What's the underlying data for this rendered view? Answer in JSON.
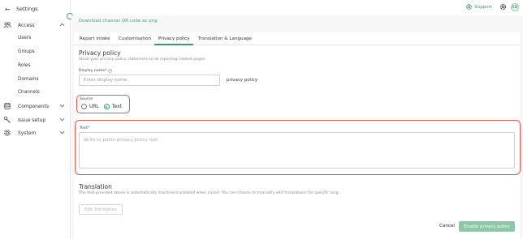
{
  "sidebar": {
    "back_label": "Settings",
    "items": [
      {
        "label": "Access",
        "icon": "users-icon",
        "expanded": true
      },
      {
        "label": "Components",
        "icon": "database-icon",
        "expanded": false
      },
      {
        "label": "Issue setup",
        "icon": "wrench-icon",
        "expanded": false
      },
      {
        "label": "System",
        "icon": "gear-icon",
        "expanded": false
      }
    ],
    "access_subitems": [
      "Users",
      "Groups",
      "Roles",
      "Domains",
      "Channels"
    ]
  },
  "topbar": {
    "support_label": "Support",
    "avatar_initials": "KD"
  },
  "download_link": "Download channel QR code as png",
  "tabs": [
    {
      "label": "Report intake",
      "active": false
    },
    {
      "label": "Customisation",
      "active": false
    },
    {
      "label": "Privacy policy",
      "active": true
    },
    {
      "label": "Translation & Language",
      "active": false
    }
  ],
  "privacy": {
    "title": "Privacy policy",
    "subtitle": "Show your privacy policy statement on all reporting related pages.",
    "display_name_label": "Display name*",
    "display_name_placeholder": "Enter display name",
    "display_name_suffix": "privacy policy",
    "source_label": "Source",
    "source_options": [
      "URL",
      "Text"
    ],
    "source_selected": "Text",
    "text_label": "Text*",
    "text_placeholder": "Write or paste privacy policy text"
  },
  "translation": {
    "title": "Translation",
    "subtitle": "The text provided above is automatically machine translated when saved. You can choose to manually edit translations for specific lang...",
    "edit_button": "Edit Translation"
  },
  "footer": {
    "cancel_label": "Cancel",
    "primary_label": "Enable privacy policy"
  },
  "colors": {
    "accent": "#3a9a6c",
    "primary_button": "#8bc9a6",
    "highlight": "#e15a4f"
  }
}
